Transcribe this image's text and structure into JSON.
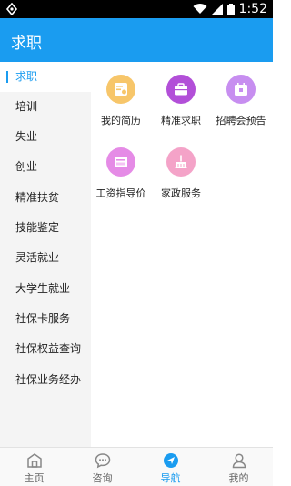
{
  "status_bar": {
    "time": "1:52"
  },
  "app_bar": {
    "title": "求职"
  },
  "sidebar": {
    "items": [
      {
        "label": "求职",
        "active": true
      },
      {
        "label": "培训"
      },
      {
        "label": "失业"
      },
      {
        "label": "创业"
      },
      {
        "label": "精准扶贫"
      },
      {
        "label": "技能鉴定"
      },
      {
        "label": "灵活就业"
      },
      {
        "label": "大学生就业"
      },
      {
        "label": "社保卡服务"
      },
      {
        "label": "社保权益查询"
      },
      {
        "label": "社保业务经办"
      }
    ]
  },
  "services": [
    {
      "label": "我的简历",
      "icon": "resume-icon",
      "color": "#f7c66a"
    },
    {
      "label": "精准求职",
      "icon": "briefcase-icon",
      "color": "#b24fd8"
    },
    {
      "label": "招聘会预告",
      "icon": "calendar-icon",
      "color": "#c78ef0"
    },
    {
      "label": "工资指导价",
      "icon": "wage-icon",
      "color": "#e58be6"
    },
    {
      "label": "家政服务",
      "icon": "broom-icon",
      "color": "#f4a3c8"
    }
  ],
  "bottom_nav": {
    "items": [
      {
        "label": "主页",
        "icon": "home-icon"
      },
      {
        "label": "咨询",
        "icon": "chat-icon"
      },
      {
        "label": "导航",
        "icon": "navigation-icon",
        "active": true
      },
      {
        "label": "我的",
        "icon": "user-icon"
      }
    ]
  },
  "colors": {
    "accent": "#1a9cf0",
    "sidebar_bg": "#f4f4f4"
  }
}
